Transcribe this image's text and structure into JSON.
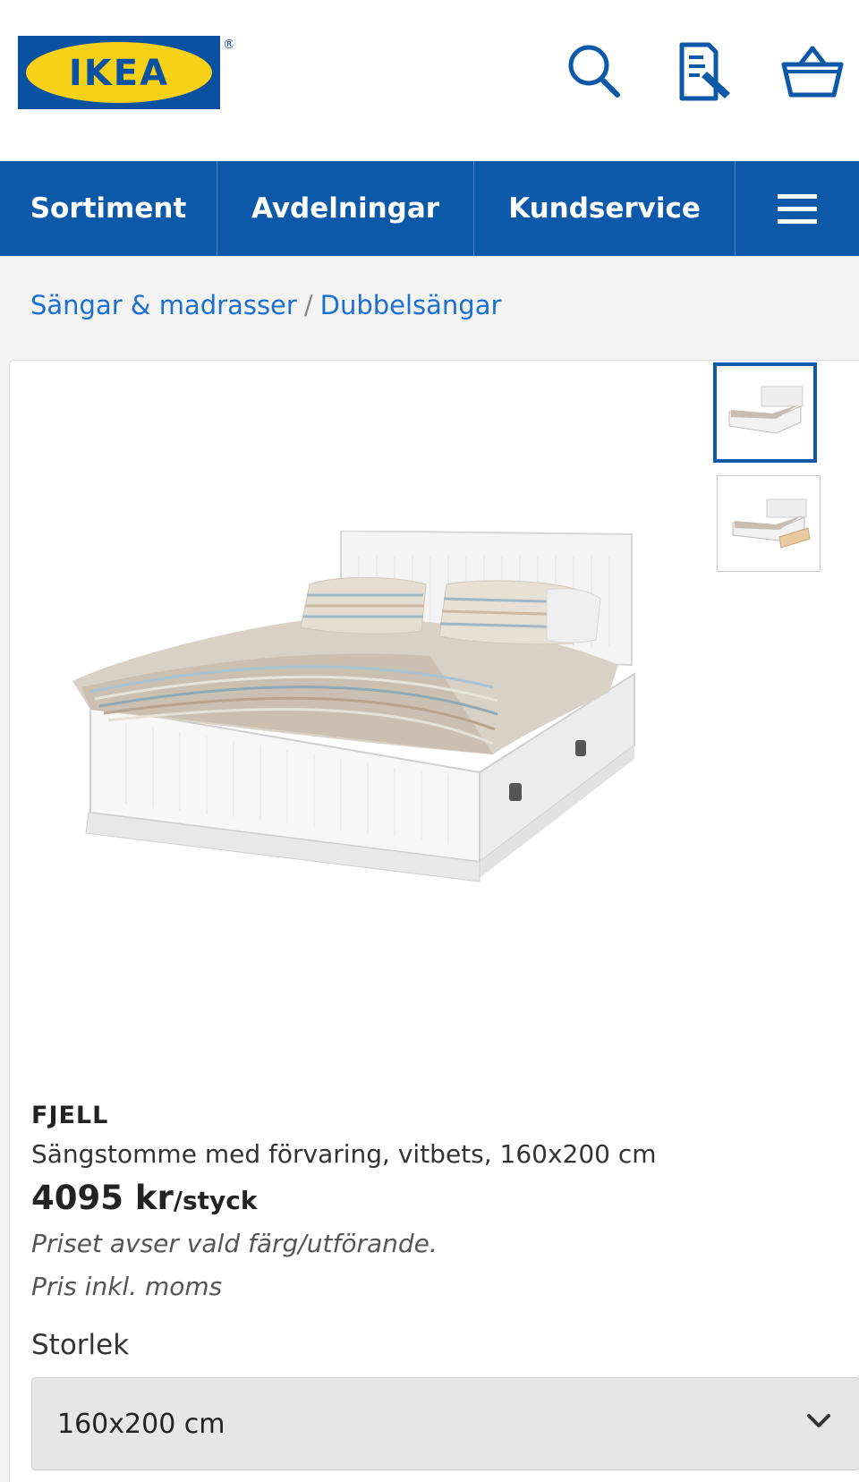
{
  "brand": {
    "logo_text": "IKEA",
    "registered_mark": "®",
    "blue": "#0c58a9",
    "yellow": "#f7d117"
  },
  "header_icons": {
    "search": "search-icon",
    "list": "shopping-list-icon",
    "basket": "basket-icon"
  },
  "nav": {
    "items": [
      {
        "label": "Sortiment"
      },
      {
        "label": "Avdelningar"
      },
      {
        "label": "Kundservice"
      }
    ],
    "menu_icon": "hamburger-menu-icon"
  },
  "breadcrumb": {
    "parent": "Sängar & madrasser",
    "separator": "/",
    "current": "Dubbelsängar"
  },
  "product": {
    "name": "FJELL",
    "description": "Sängstomme med förvaring, vitbets, 160x200 cm",
    "price_amount": "4095 kr",
    "price_unit": "/styck",
    "note1": "Priset avser vald färg/utförande.",
    "note2": "Pris inkl. moms",
    "size_label": "Storlek",
    "size_selected": "160x200 cm"
  }
}
